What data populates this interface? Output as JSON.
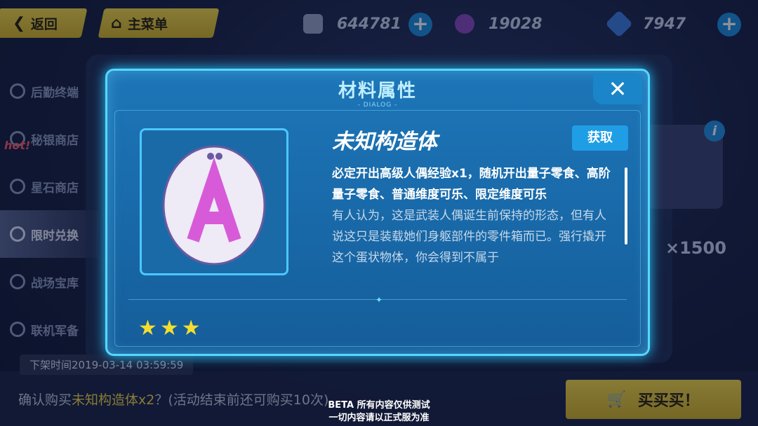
{
  "topbar": {
    "back_label": "返回",
    "menu_label": "主菜单",
    "currencies": [
      {
        "icon": "device-icon",
        "value": "644781"
      },
      {
        "icon": "crystal-orb-icon",
        "value": "19028"
      },
      {
        "icon": "gem-icon",
        "value": "7947"
      }
    ]
  },
  "sidebar": {
    "hot_badge": "hot!",
    "items": [
      {
        "label": "后勤终端",
        "icon": "logistics-icon"
      },
      {
        "label": "秘银商店",
        "icon": "mithril-icon"
      },
      {
        "label": "星石商店",
        "icon": "star-stone-icon"
      },
      {
        "label": "限时兑换",
        "icon": "limited-exchange-icon"
      },
      {
        "label": "战场宝库",
        "icon": "battlefield-icon"
      },
      {
        "label": "联机军备",
        "icon": "coop-icon"
      }
    ]
  },
  "background": {
    "price": "×1500"
  },
  "bottom": {
    "removal_time": "下架时间2019-03-14 03:59:59",
    "confirm_prefix": "确认购买",
    "confirm_item": "未知构造体",
    "confirm_qty": "x2",
    "confirm_suffix": "？(活动结束前还可购买10次)",
    "buy_label": "买买买！"
  },
  "dialog": {
    "title": "材料属性",
    "subtitle": "- DIALOG -",
    "close_label": "✕",
    "item_name": "未知构造体",
    "obtain_label": "获取",
    "desc_strong": "必定开出高级人偶经验x1，随机开出量子零食、高阶量子零食、普通维度可乐、限定维度可乐",
    "desc_flavor": "有人认为，这是武装人偶诞生前保持的形态，但有人说这只是装载她们身躯部件的零件箱而已。强行撬开这个蛋状物体，你会得到不属于",
    "stars": 3,
    "star_glyphs": "★★★"
  },
  "beta": {
    "line1": "BETA  所有内容仅供测试",
    "line2": "一切内容请以正式服为准"
  },
  "colors": {
    "accent_yellow": "#f2d84a",
    "dialog_blue": "#1d76b8",
    "glow": "#55d8ff"
  }
}
